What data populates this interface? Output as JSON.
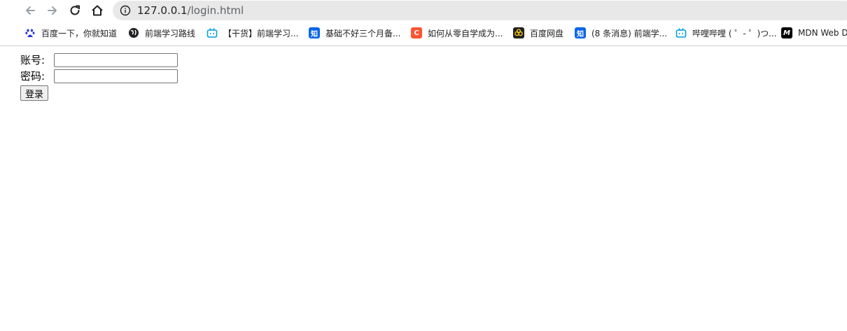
{
  "browser": {
    "url_host": "127.0.0.1",
    "url_path": "/login.html"
  },
  "bookmarks": [
    {
      "label": "百度一下，你就知道",
      "icon": "baidu-paw-icon",
      "color": "#2932e1"
    },
    {
      "label": "前端学习路线",
      "icon": "globe-icon",
      "color": "#202124"
    },
    {
      "label": "【干货】前端学习...",
      "icon": "bilibili-tv-icon",
      "color": "#00a1d6"
    },
    {
      "label": "基础不好三个月备...",
      "icon": "zhihu-icon",
      "color": "#0a66e8",
      "glyph": "知"
    },
    {
      "label": "如何从零自学成为...",
      "icon": "csdn-icon",
      "color": "#fc5531",
      "glyph": "C"
    },
    {
      "label": "百度网盘",
      "icon": "baidu-netdisk-icon",
      "color": "#202124"
    },
    {
      "label": "(8 条消息) 前端学...",
      "icon": "zhihu-icon",
      "color": "#0a66e8",
      "glyph": "知"
    },
    {
      "label": "哔哩哔哩 ( ゜- ゜)つ...",
      "icon": "bilibili-tv-icon",
      "color": "#00a1d6"
    },
    {
      "label": "MDN Web D",
      "icon": "mdn-icon",
      "color": "#000000",
      "glyph": "M"
    }
  ],
  "form": {
    "account_label": "账号:",
    "account_value": "",
    "password_label": "密码:",
    "password_value": "",
    "submit_label": "登录"
  }
}
